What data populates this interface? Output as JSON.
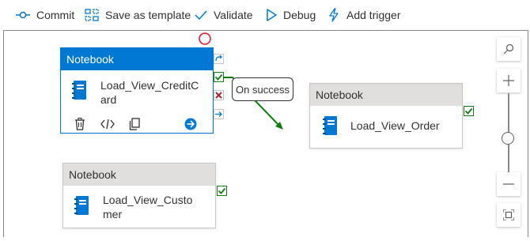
{
  "toolbar": {
    "commit_label": "Commit",
    "save_template_label": "Save as template",
    "validate_label": "Validate",
    "debug_label": "Debug",
    "add_trigger_label": "Add trigger"
  },
  "activities": [
    {
      "header": "Notebook",
      "name": "Load_View_CreditCard"
    },
    {
      "header": "Notebook",
      "name": "Load_View_Order"
    },
    {
      "header": "Notebook",
      "name": "Load_View_Customer"
    }
  ],
  "connection": {
    "label": "On success"
  },
  "colors": {
    "accent": "#0078d4",
    "success": "#107c10",
    "failure": "#a4262c",
    "header_grey": "#e1dfdd"
  }
}
